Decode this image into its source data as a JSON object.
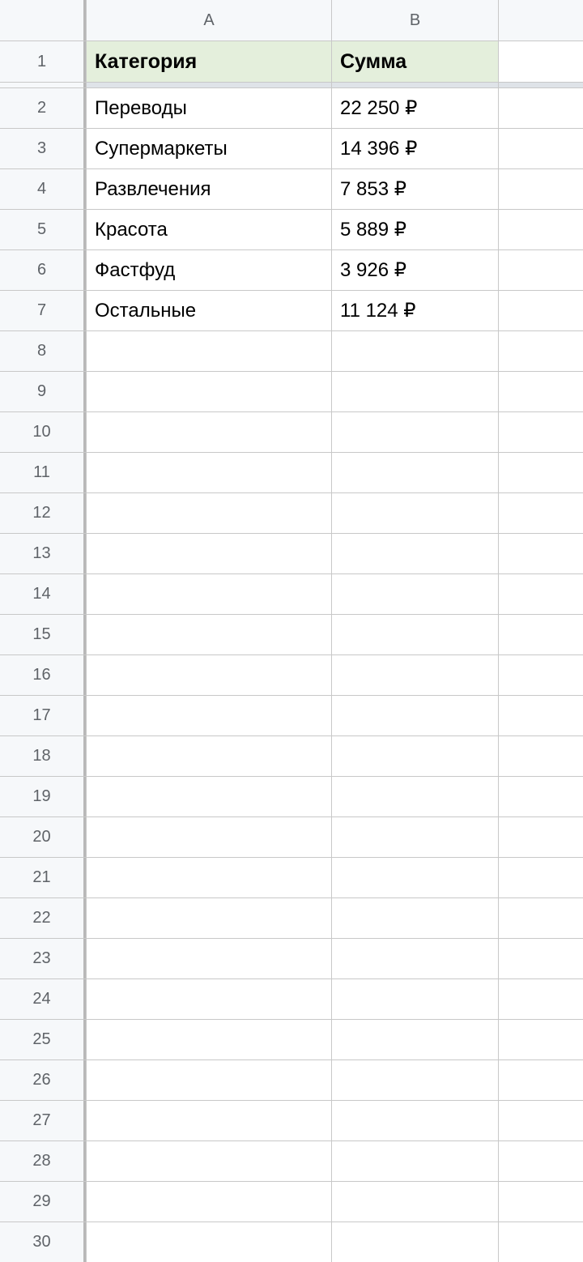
{
  "columns": [
    "A",
    "B"
  ],
  "headers": {
    "category": "Категория",
    "sum": "Сумма"
  },
  "rows": [
    {
      "num": "1"
    },
    {
      "num": "2",
      "category": "Переводы",
      "sum": "22 250 ₽"
    },
    {
      "num": "3",
      "category": "Супермаркеты",
      "sum": "14 396 ₽"
    },
    {
      "num": "4",
      "category": "Развлечения",
      "sum": "7 853 ₽"
    },
    {
      "num": "5",
      "category": "Красота",
      "sum": "5 889 ₽"
    },
    {
      "num": "6",
      "category": "Фастфуд",
      "sum": "3 926 ₽"
    },
    {
      "num": "7",
      "category": "Остальные",
      "sum": "11 124 ₽"
    },
    {
      "num": "8"
    },
    {
      "num": "9"
    },
    {
      "num": "10"
    },
    {
      "num": "11"
    },
    {
      "num": "12"
    },
    {
      "num": "13"
    },
    {
      "num": "14"
    },
    {
      "num": "15"
    },
    {
      "num": "16"
    },
    {
      "num": "17"
    },
    {
      "num": "18"
    },
    {
      "num": "19"
    },
    {
      "num": "20"
    },
    {
      "num": "21"
    },
    {
      "num": "22"
    },
    {
      "num": "23"
    },
    {
      "num": "24"
    },
    {
      "num": "25"
    },
    {
      "num": "26"
    },
    {
      "num": "27"
    },
    {
      "num": "28"
    },
    {
      "num": "29"
    },
    {
      "num": "30"
    }
  ]
}
